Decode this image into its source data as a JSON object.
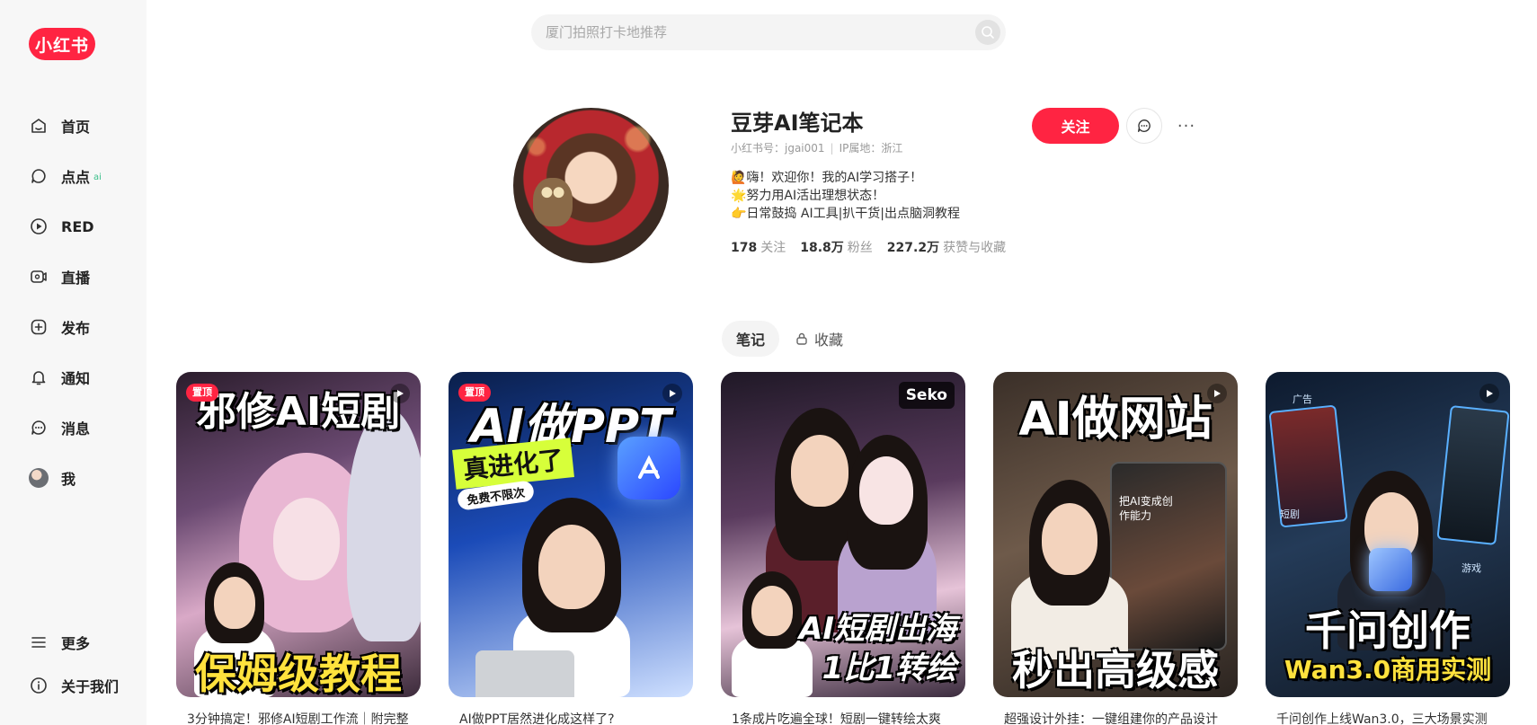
{
  "sidebar": {
    "logo": "小红书",
    "items": [
      {
        "label": "首页",
        "icon": "home-icon"
      },
      {
        "label": "点点",
        "icon": "chat-bubble-icon",
        "badge": "ai"
      },
      {
        "label": "RED",
        "icon": "play-circle-icon"
      },
      {
        "label": "直播",
        "icon": "live-icon"
      },
      {
        "label": "发布",
        "icon": "plus-square-icon"
      },
      {
        "label": "通知",
        "icon": "bell-icon"
      },
      {
        "label": "消息",
        "icon": "message-icon"
      },
      {
        "label": "我",
        "icon": "avatar"
      }
    ],
    "bottom": [
      {
        "label": "更多",
        "icon": "menu-icon"
      },
      {
        "label": "关于我们",
        "icon": "info-icon"
      }
    ]
  },
  "search": {
    "placeholder": "厦门拍照打卡地推荐"
  },
  "profile": {
    "name": "豆芽AI笔记本",
    "id_label": "小红书号：jgai001",
    "ip_label": "IP属地：浙江",
    "bio": [
      "🙋嗨！欢迎你！我的AI学习搭子！",
      "🌟努力用AI活出理想状态！",
      "👉日常鼓捣 AI工具|扒干货|出点脑洞教程"
    ],
    "stats": [
      {
        "num": "178",
        "label": "关注"
      },
      {
        "num": "18.8万",
        "label": "粉丝"
      },
      {
        "num": "227.2万",
        "label": "获赞与收藏"
      }
    ],
    "follow_label": "关注",
    "more_label": "···"
  },
  "tabs": {
    "notes": "笔记",
    "collect": "收藏"
  },
  "cards": [
    {
      "title": "3分钟搞定！邪修AI短剧工作流｜附完整",
      "pin": "置顶",
      "headline_top": "邪修AI短剧",
      "headline_bottom": "保姆级教程"
    },
    {
      "title": "AI做PPT居然进化成这样了?",
      "pin": "置顶",
      "headline_top": "AI做PPT",
      "headline_mid": "真进化了",
      "tag": "免费不限次"
    },
    {
      "title": "1条成片吃遍全球！短剧一键转绘太爽",
      "brand": "Seko",
      "headline_bottom": "AI短剧出海",
      "headline_bottom2": "1比1转绘"
    },
    {
      "title": "超强设计外挂：一键组建你的产品设计",
      "headline_top": "AI做网站",
      "headline_bottom": "秒出高级感",
      "screen_text": "把AI变成创作能力"
    },
    {
      "title": "千问创作上线Wan3.0，三大场景实测",
      "headline_bottom": "千问创作",
      "headline_bottom2": "Wan3.0商用实测",
      "tag_ad": "广告",
      "tag_drama": "短剧",
      "tag_game": "游戏"
    }
  ],
  "colors": {
    "brand": "#ff2442",
    "sidebar_bg": "#f7f7f7"
  }
}
